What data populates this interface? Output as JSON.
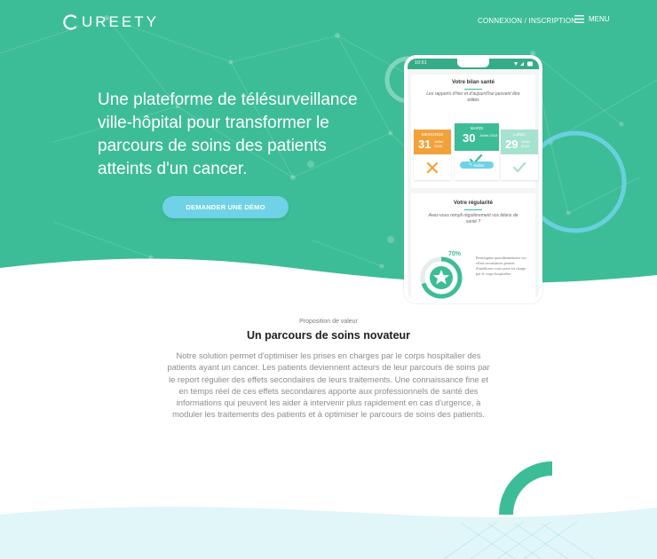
{
  "colors": {
    "brand_green": "#3dbd97",
    "accent_cyan": "#6fd2e6",
    "orange": "#f2a23a",
    "light_green": "#a6e2cf"
  },
  "header": {
    "logo_text": "UREETY",
    "login_label": "CONNEXION / INSCRIPTION",
    "menu_label": "MENU",
    "menu_icon": "hamburger-icon"
  },
  "hero": {
    "title": "Une plateforme de télésurveillance ville-hôpital pour transformer le parcours de soins des patients atteints d'un cancer.",
    "cta_label": "DEMANDER UNE DÉMO"
  },
  "phone": {
    "time": "10:51",
    "health_card": {
      "title": "Votre bilan santé",
      "subtitle": "Les rapports d'hier et d'aujourd'hui peuvent être édités",
      "days": [
        {
          "name": "MERCREDI",
          "num": "31",
          "month": "Juillet 2018",
          "status": "cross-icon"
        },
        {
          "name": "MARDI",
          "num": "30",
          "month": "Juillet 2018",
          "status": "check-icon",
          "edit_label": "Editer"
        },
        {
          "name": "LUNDI",
          "num": "29",
          "month": "Juillet 2018",
          "status": "check-icon"
        }
      ]
    },
    "regularity_card": {
      "title": "Votre régularité",
      "question": "Avez-vous rempli régulièrement vos bilans de santé ?",
      "percent": "70%",
      "progress": 0.7,
      "note": "Renseignez quotidiennement vos effets secondaires permet d'améliorer votre prise en charge par le corps hospitalier"
    }
  },
  "intro": {
    "eyebrow": "Proposition de valeur",
    "title": "Un parcours de soins novateur",
    "body": "Notre solution permet d'optimiser les prises en charges par le corps hospitalier des patients ayant un cancer. Les patients deviennent acteurs de leur parcours de soins par le report régulier des effets secondaires de leurs traitements. Une connaissance fine et en temps réel de ces effets secondaires apporte aux professionnels de santé des informations qui peuvent les aider à intervenir plus rapidement en cas d'urgence, à moduler les traitements des patients et à optimiser le parcours de soins des patients."
  }
}
